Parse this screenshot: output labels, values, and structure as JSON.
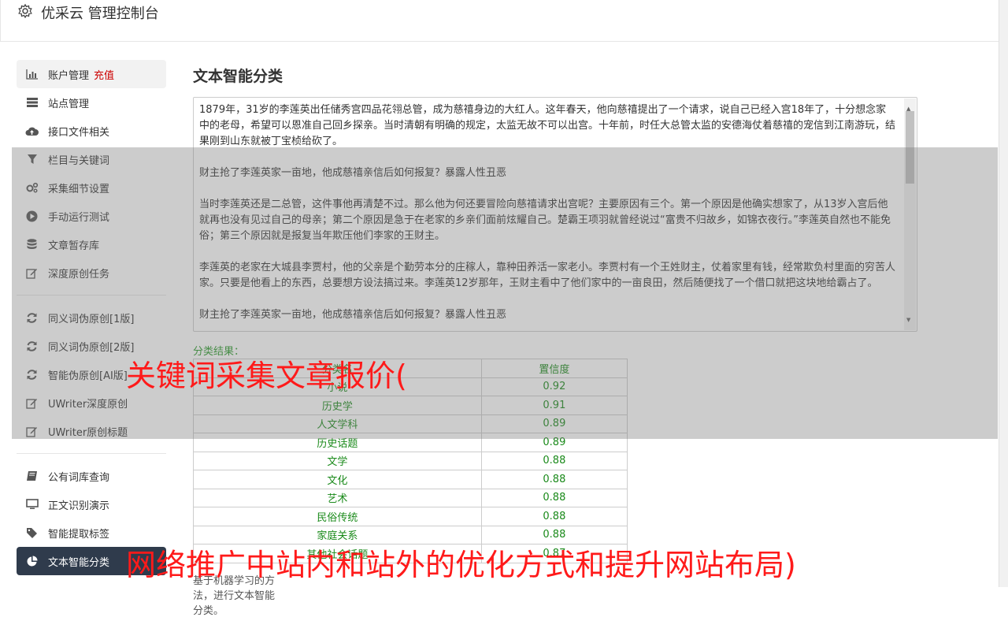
{
  "header": {
    "title": "优采云 管理控制台"
  },
  "sidebar": {
    "group1": [
      {
        "label": "账户管理",
        "tag": "充值",
        "icon": "bar-chart-icon"
      },
      {
        "label": "站点管理",
        "icon": "server-icon"
      },
      {
        "label": "接口文件相关",
        "icon": "cloud-upload-icon"
      },
      {
        "label": "栏目与关键词",
        "icon": "filter-icon"
      },
      {
        "label": "采集细节设置",
        "icon": "gears-icon"
      },
      {
        "label": "手动运行测试",
        "icon": "play-circle-icon"
      },
      {
        "label": "文章暂存库",
        "icon": "database-icon"
      },
      {
        "label": "深度原创任务",
        "icon": "edit-icon"
      }
    ],
    "group2": [
      {
        "label": "同义词伪原创[1版]",
        "icon": "refresh-icon"
      },
      {
        "label": "同义词伪原创[2版]",
        "icon": "refresh-icon"
      },
      {
        "label": "智能伪原创[AI版]",
        "icon": "refresh-icon"
      },
      {
        "label": "UWriter深度原创",
        "icon": "edit-icon"
      },
      {
        "label": "UWriter原创标题",
        "icon": "edit-icon"
      }
    ],
    "group3": [
      {
        "label": "公有词库查询",
        "icon": "book-icon"
      },
      {
        "label": "正文识别演示",
        "icon": "monitor-icon"
      },
      {
        "label": "智能提取标签",
        "icon": "tag-icon"
      },
      {
        "label": "文本智能分类",
        "icon": "pie-chart-icon"
      }
    ]
  },
  "main": {
    "title": "文本智能分类",
    "paragraphs": [
      "1879年，31岁的李莲英出任储秀宫四品花翎总管，成为慈禧身边的大红人。这年春天，他向慈禧提出了一个请求，说自己已经入宫18年了，十分想念家中的老母，希望可以恩准自己回乡探亲。当时清朝有明确的规定，太监无故不可以出宫。十年前，时任大总管太监的安德海仗着慈禧的宠信到江南游玩，结果刚到山东就被丁宝桢给砍了。",
      "财主抢了李莲英家一亩地，他成慈禧亲信后如何报复？暴露人性丑恶",
      "当时李莲英还是二总管，这件事他再清楚不过。那么他为何还要冒险向慈禧请求出宫呢？主要原因有三个。第一个原因是他确实想家了，从13岁入宫后他就再也没有见过自己的母亲；第二个原因是急于在老家的乡亲们面前炫耀自己。楚霸王项羽就曾经说过“富贵不归故乡，如锦衣夜行。”李莲英自然也不能免俗；第三个原因就是报复当年欺压他们李家的王财主。",
      "李莲英的老家在大城县李贾村，他的父亲是个勤劳本分的庄稼人，靠种田养活一家老小。李贾村有一个王姓财主，仗着家里有钱，经常欺负村里面的穷苦人家。只要是他看上的东西，总要想方设法搞过来。李莲英12岁那年，王财主看中了他们家中的一亩良田，然后随便找了一个借口就把这块地给霸占了。",
      "财主抢了李莲英家一亩地，他成慈禧亲信后如何报复？暴露人性丑恶"
    ],
    "result_label": "分类结果：",
    "table_headers": [
      "分类名",
      "置信度"
    ],
    "rows": [
      [
        "小说",
        "0.92"
      ],
      [
        "历史学",
        "0.91"
      ],
      [
        "人文学科",
        "0.89"
      ],
      [
        "历史话题",
        "0.89"
      ],
      [
        "文学",
        "0.88"
      ],
      [
        "文化",
        "0.88"
      ],
      [
        "艺术",
        "0.88"
      ],
      [
        "民俗传统",
        "0.88"
      ],
      [
        "家庭关系",
        "0.88"
      ],
      [
        "其他社会话题",
        "0.87"
      ]
    ],
    "footnote": "基于机器学习的方法，进行文本智能分类。"
  },
  "overlay": {
    "text1": "关键词采集文章报价(",
    "text2": "网络推广中站内和站外的优化方式和提升网站布局)"
  }
}
